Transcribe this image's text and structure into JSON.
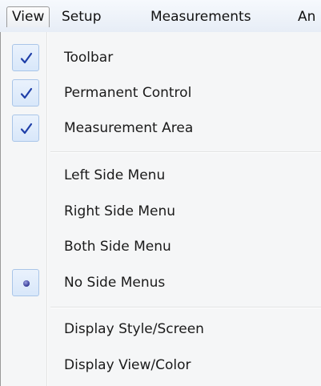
{
  "menubar": {
    "items": [
      {
        "label": "View"
      },
      {
        "label": "Setup"
      },
      {
        "label": "Measurements"
      },
      {
        "label": "An"
      }
    ]
  },
  "view_menu": {
    "items": [
      {
        "label": "Toolbar",
        "state": "checked"
      },
      {
        "label": "Permanent Control",
        "state": "checked"
      },
      {
        "label": "Measurement Area",
        "state": "checked"
      },
      {
        "label": "Left Side Menu",
        "state": "none"
      },
      {
        "label": "Right Side Menu",
        "state": "none"
      },
      {
        "label": "Both Side Menu",
        "state": "none"
      },
      {
        "label": "No Side Menus",
        "state": "selected"
      },
      {
        "label": "Display Style/Screen",
        "state": "none"
      },
      {
        "label": "Display View/Color",
        "state": "none"
      }
    ]
  },
  "colors": {
    "check": "#1f3fa8",
    "radio": "#3b3f9e",
    "highlight_border": "#a9c5e8"
  },
  "icons": {
    "check": "check-icon",
    "radio": "radio-bullet-icon"
  }
}
